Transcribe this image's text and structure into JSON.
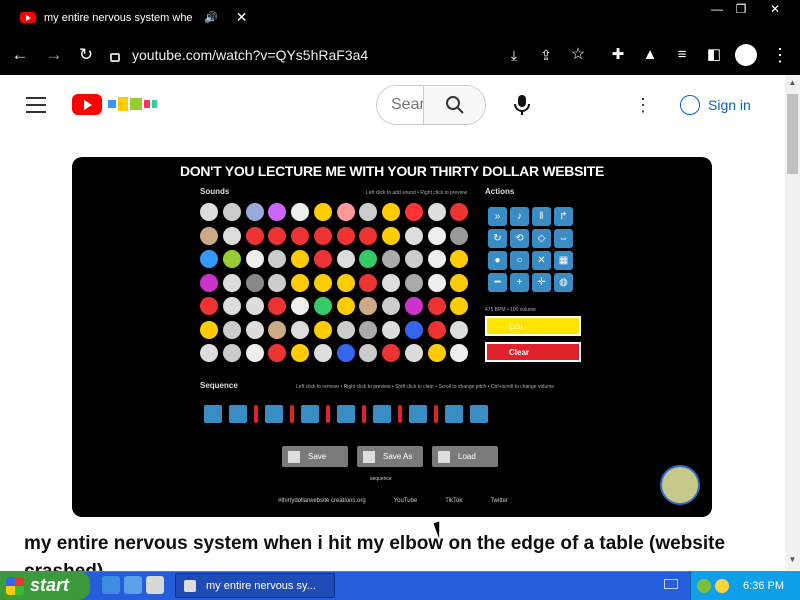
{
  "browser": {
    "tab_title": "my entire nervous system whe",
    "url": "youtube.com/watch?v=QYs5hRaF3a4",
    "window_controls": [
      "minimize",
      "restore",
      "close"
    ],
    "nav_icons": [
      "back-icon",
      "forward-icon",
      "reload-icon"
    ],
    "toolbar_icons": [
      "install-icon",
      "share-icon",
      "star-icon",
      "extensions-icon",
      "labs-icon",
      "media-icon",
      "sidepanel-icon",
      "profile-icon",
      "menu-icon"
    ]
  },
  "youtube": {
    "search_placeholder": "Search",
    "sign_in": "Sign in"
  },
  "video": {
    "player_title": "DON'T YOU LECTURE ME WITH YOUR THIRTY DOLLAR WEBSITE",
    "sounds_heading": "Sounds",
    "actions_heading": "Actions",
    "sequence_heading": "Sequence",
    "sounds_hint": "Left click to add sound • Right click to preview",
    "sequence_hint": "Left click to remove • Right click to preview • Shift click to clear • Scroll to change pitch • Ctrl+scroll to change volume",
    "bpm_text": "475 BPM • 100 volume",
    "yellow_btn": "Edit",
    "clear_btn": "Clear",
    "save_btn": "Save",
    "save_as_btn": "Save As",
    "load_btn": "Load",
    "sequence_field": "sequence",
    "footer_links": [
      "#thirtydollarwebsite creations.org",
      "YouTube",
      "TikTok",
      "Twitter"
    ],
    "heading": "my entire nervous system when i hit my elbow on the edge of a table (website crashed)"
  },
  "taskbar": {
    "start": "start",
    "task_item": "my entire nervous sy...",
    "clock": "6:36 PM"
  },
  "colors": {
    "yt_red": "#ff0000",
    "link_blue": "#065fd4",
    "taskbar_blue": "#245edb",
    "start_green": "#3c9a3a",
    "tray_blue": "#0f9fe6",
    "action_blue": "#3a8cc4",
    "clear_red": "#e0202a",
    "edit_yellow": "#ffe500"
  }
}
